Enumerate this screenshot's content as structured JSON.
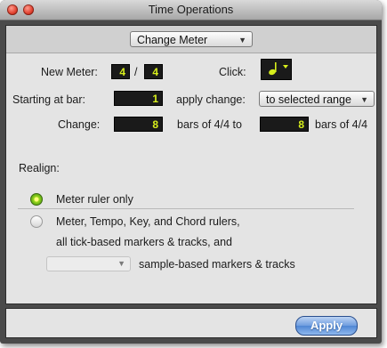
{
  "window": {
    "title": "Time Operations"
  },
  "operation": {
    "selected": "Change Meter"
  },
  "new_meter": {
    "label": "New Meter:",
    "numerator": "4",
    "separator": "/",
    "denominator": "4"
  },
  "click": {
    "label": "Click:",
    "value_icon": "quarter-note-icon"
  },
  "starting_at_bar": {
    "label": "Starting at bar:",
    "value": "1"
  },
  "apply_change": {
    "label": "apply change:",
    "selected": "to selected range"
  },
  "change": {
    "label": "Change:",
    "from_value": "8",
    "from_suffix": "bars of 4/4 to",
    "to_value": "8",
    "to_suffix": "bars of 4/4"
  },
  "realign": {
    "label": "Realign:",
    "option1": "Meter ruler only",
    "option2_line1": "Meter, Tempo, Key, and Chord rulers,",
    "option2_line2": "all tick-based markers & tracks, and",
    "option2_line3": "sample-based markers & tracks",
    "selected": "option1"
  },
  "footer": {
    "apply_label": "Apply"
  },
  "colors": {
    "lcd_text": "#d7ee1c",
    "accent": "#4f86d4"
  }
}
